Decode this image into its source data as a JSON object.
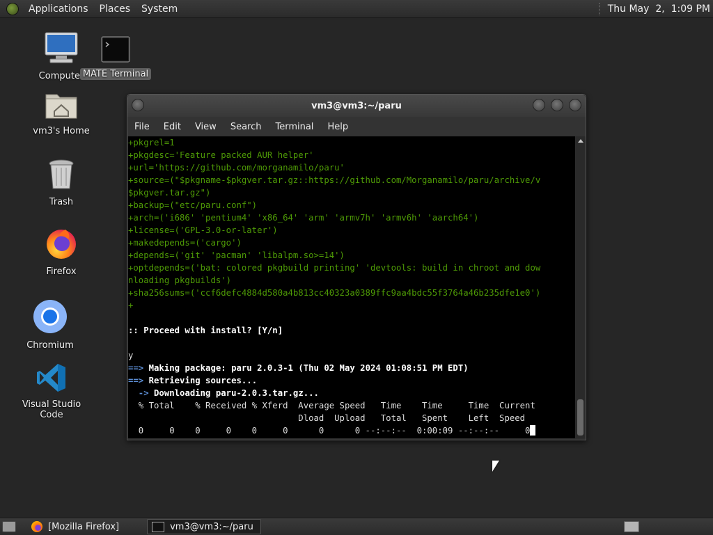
{
  "top_panel": {
    "menus": [
      "Applications",
      "Places",
      "System"
    ],
    "clock": "Thu May  2,  1:09 PM"
  },
  "desktop_icons": {
    "computer": "Computer",
    "mate_terminal": "MATE Terminal",
    "home": "vm3's Home",
    "trash": "Trash",
    "firefox": "Firefox",
    "chromium": "Chromium",
    "vscode": "Visual Studio Code"
  },
  "terminal": {
    "title": "vm3@vm3:~/paru",
    "menu": [
      "File",
      "Edit",
      "View",
      "Search",
      "Terminal",
      "Help"
    ],
    "lines": [
      {
        "t": "+pkgrel=1",
        "c": "g"
      },
      {
        "t": "+pkgdesc='Feature packed AUR helper'",
        "c": "g"
      },
      {
        "t": "+url='https://github.com/morganamilo/paru'",
        "c": "g"
      },
      {
        "t": "+source=(\"$pkgname-$pkgver.tar.gz::https://github.com/Morganamilo/paru/archive/v",
        "c": "g"
      },
      {
        "t": "$pkgver.tar.gz\")",
        "c": "g"
      },
      {
        "t": "+backup=(\"etc/paru.conf\")",
        "c": "g"
      },
      {
        "t": "+arch=('i686' 'pentium4' 'x86_64' 'arm' 'armv7h' 'armv6h' 'aarch64')",
        "c": "g"
      },
      {
        "t": "+license=('GPL-3.0-or-later')",
        "c": "g"
      },
      {
        "t": "+makedepends=('cargo')",
        "c": "g"
      },
      {
        "t": "+depends=('git' 'pacman' 'libalpm.so>=14')",
        "c": "g"
      },
      {
        "t": "+optdepends=('bat: colored pkgbuild printing' 'devtools: build in chroot and dow",
        "c": "g"
      },
      {
        "t": "nloading pkgbuilds')",
        "c": "g"
      },
      {
        "t": "+sha256sums=('ccf6defc4884d580a4b813cc40323a0389ffc9aa4bdc55f3764a46b235dfe1e0')",
        "c": "g"
      },
      {
        "t": "+",
        "c": "g"
      },
      {
        "t": "",
        "c": "n"
      },
      {
        "t": ":: Proceed with install? [Y/n]",
        "c": "b"
      },
      {
        "t": "",
        "c": "n"
      },
      {
        "t": "y",
        "c": "n"
      }
    ],
    "making": {
      "arrow": "==>",
      "text": " Making package: paru 2.0.3-1 (Thu 02 May 2024 01:08:51 PM EDT)"
    },
    "retrieving": {
      "arrow": "==>",
      "text": " Retrieving sources..."
    },
    "downloading": {
      "arrow": "  ->",
      "text": " Downloading paru-2.0.3.tar.gz..."
    },
    "curl_header1": "  % Total    % Received % Xferd  Average Speed   Time    Time     Time  Current",
    "curl_header2": "                                 Dload  Upload   Total   Spent    Left  Speed",
    "curl_progress": "  0     0    0     0    0     0      0      0 --:--:--  0:00:09 --:--:--     0"
  },
  "taskbar": {
    "tasks": [
      "[Mozilla Firefox]",
      "vm3@vm3:~/paru"
    ]
  }
}
